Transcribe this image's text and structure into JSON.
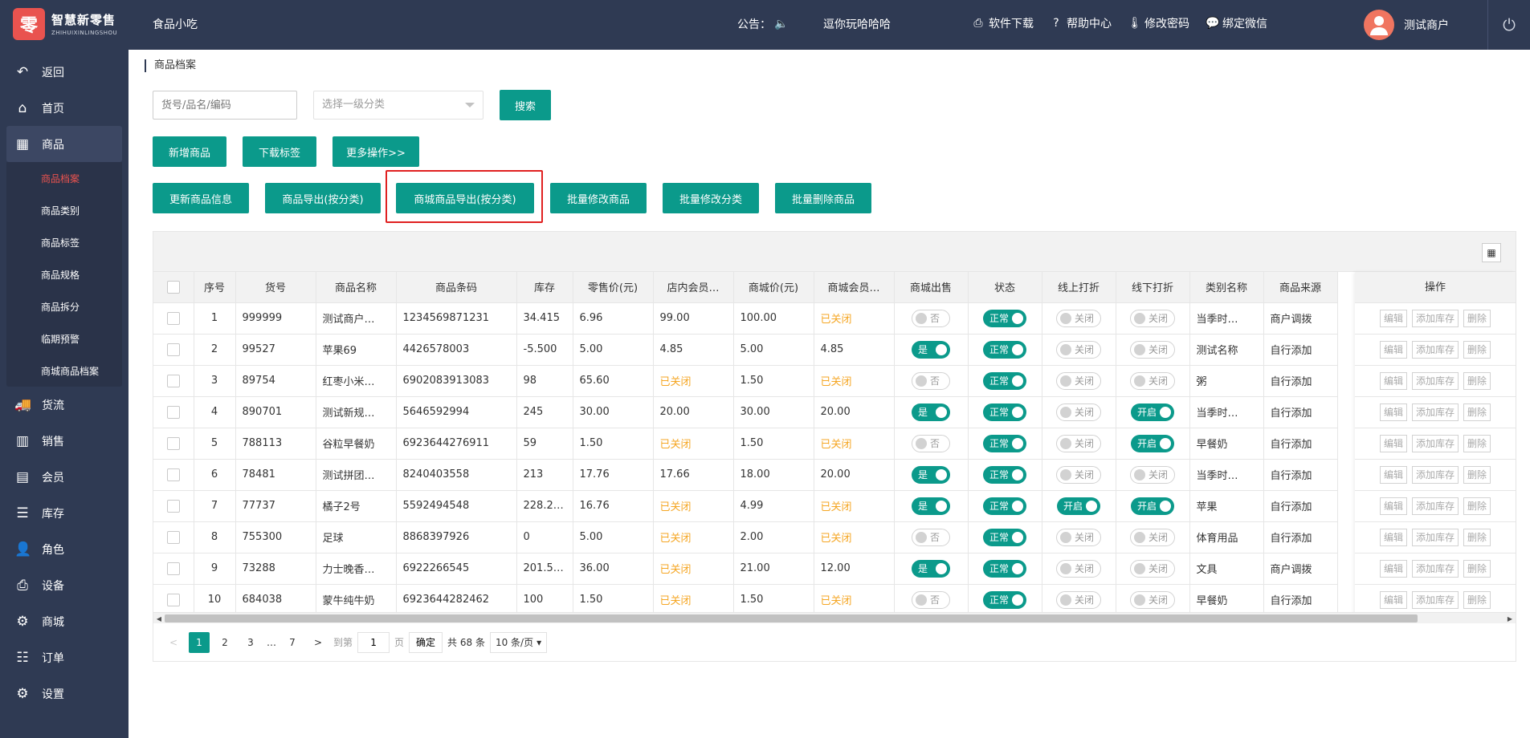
{
  "header": {
    "logo_glyph": "零",
    "logo_title": "智慧新零售",
    "logo_sub": "ZHIHUIXINLINGSHOU",
    "store": "食品小吃",
    "notice_label": "公告：",
    "notice_text": "逗你玩哈哈哈",
    "links": [
      "软件下载",
      "帮助中心",
      "修改密码",
      "绑定微信"
    ],
    "merchant": "测试商户"
  },
  "sidebar": {
    "items": [
      "返回",
      "首页",
      "商品",
      "货流",
      "销售",
      "会员",
      "库存",
      "角色",
      "设备",
      "商城",
      "订单",
      "设置"
    ],
    "sub_items": [
      "商品档案",
      "商品类别",
      "商品标签",
      "商品规格",
      "商品拆分",
      "临期预警",
      "商城商品档案"
    ]
  },
  "breadcrumb": "商品档案",
  "search": {
    "placeholder": "货号/品名/编码",
    "category_placeholder": "选择一级分类",
    "button": "搜索"
  },
  "actions_row1": [
    "新增商品",
    "下载标签",
    "更多操作>>"
  ],
  "actions_row2": [
    "更新商品信息",
    "商品导出(按分类)",
    "商城商品导出(按分类)",
    "批量修改商品",
    "批量修改分类",
    "批量删除商品"
  ],
  "table": {
    "headers": [
      "序号",
      "货号",
      "商品名称",
      "商品条码",
      "库存",
      "零售价(元)",
      "店内会员…",
      "商城价(元)",
      "商城会员…",
      "商城出售",
      "状态",
      "线上打折",
      "线下打折",
      "类别名称",
      "商品来源",
      "操作"
    ],
    "ops": [
      "编辑",
      "添加库存",
      "删除"
    ],
    "rows": [
      {
        "no": "1",
        "code": "999999",
        "name": "测试商户…",
        "barcode": "1234569871231",
        "stock": "34.415",
        "retail": "6.96",
        "member": "99.00",
        "mall": "100.00",
        "mall_member": "已关闭",
        "sell": "否",
        "status": "正常",
        "online": "关闭",
        "offline": "关闭",
        "category": "当季时…",
        "source": "商户调拨"
      },
      {
        "no": "2",
        "code": "99527",
        "name": "苹果69",
        "barcode": "4426578003",
        "stock": "-5.500",
        "retail": "5.00",
        "member": "4.85",
        "mall": "5.00",
        "mall_member": "4.85",
        "sell": "是",
        "status": "正常",
        "online": "关闭",
        "offline": "关闭",
        "category": "测试名称",
        "source": "自行添加"
      },
      {
        "no": "3",
        "code": "89754",
        "name": "红枣小米…",
        "barcode": "6902083913083",
        "stock": "98",
        "retail": "65.60",
        "member": "已关闭",
        "mall": "1.50",
        "mall_member": "已关闭",
        "sell": "否",
        "status": "正常",
        "online": "关闭",
        "offline": "关闭",
        "category": "粥",
        "source": "自行添加"
      },
      {
        "no": "4",
        "code": "890701",
        "name": "测试新规…",
        "barcode": "5646592994",
        "stock": "245",
        "retail": "30.00",
        "member": "20.00",
        "mall": "30.00",
        "mall_member": "20.00",
        "sell": "是",
        "status": "正常",
        "online": "关闭",
        "offline": "开启",
        "category": "当季时…",
        "source": "自行添加"
      },
      {
        "no": "5",
        "code": "788113",
        "name": "谷粒早餐奶",
        "barcode": "6923644276911",
        "stock": "59",
        "retail": "1.50",
        "member": "已关闭",
        "mall": "1.50",
        "mall_member": "已关闭",
        "sell": "否",
        "status": "正常",
        "online": "关闭",
        "offline": "开启",
        "category": "早餐奶",
        "source": "自行添加"
      },
      {
        "no": "6",
        "code": "78481",
        "name": "测试拼团…",
        "barcode": "8240403558",
        "stock": "213",
        "retail": "17.76",
        "member": "17.66",
        "mall": "18.00",
        "mall_member": "20.00",
        "sell": "是",
        "status": "正常",
        "online": "关闭",
        "offline": "关闭",
        "category": "当季时…",
        "source": "自行添加"
      },
      {
        "no": "7",
        "code": "77737",
        "name": "橘子2号",
        "barcode": "5592494548",
        "stock": "228.2…",
        "retail": "16.76",
        "member": "已关闭",
        "mall": "4.99",
        "mall_member": "已关闭",
        "sell": "是",
        "status": "正常",
        "online": "开启",
        "offline": "开启",
        "category": "苹果",
        "source": "自行添加"
      },
      {
        "no": "8",
        "code": "755300",
        "name": "足球",
        "barcode": "8868397926",
        "stock": "0",
        "retail": "5.00",
        "member": "已关闭",
        "mall": "2.00",
        "mall_member": "已关闭",
        "sell": "否",
        "status": "正常",
        "online": "关闭",
        "offline": "关闭",
        "category": "体育用品",
        "source": "自行添加"
      },
      {
        "no": "9",
        "code": "73288",
        "name": "力士晚香…",
        "barcode": "6922266545",
        "stock": "201.5…",
        "retail": "36.00",
        "member": "已关闭",
        "mall": "21.00",
        "mall_member": "12.00",
        "sell": "是",
        "status": "正常",
        "online": "关闭",
        "offline": "关闭",
        "category": "文具",
        "source": "商户调拨"
      },
      {
        "no": "10",
        "code": "684038",
        "name": "蒙牛纯牛奶",
        "barcode": "6923644282462",
        "stock": "100",
        "retail": "1.50",
        "member": "已关闭",
        "mall": "1.50",
        "mall_member": "已关闭",
        "sell": "否",
        "status": "正常",
        "online": "关闭",
        "offline": "关闭",
        "category": "早餐奶",
        "source": "自行添加"
      }
    ]
  },
  "pager": {
    "pages": [
      "1",
      "2",
      "3",
      "…",
      "7"
    ],
    "goto_label": "到第",
    "goto_value": "1",
    "page_unit": "页",
    "confirm": "确定",
    "total": "共 68 条",
    "page_size": "10 条/页"
  },
  "colors": {
    "header_bg": "#2f3a53",
    "accent": "#0b9a8b",
    "closed": "#f5a623",
    "highlight": "#e02020"
  }
}
